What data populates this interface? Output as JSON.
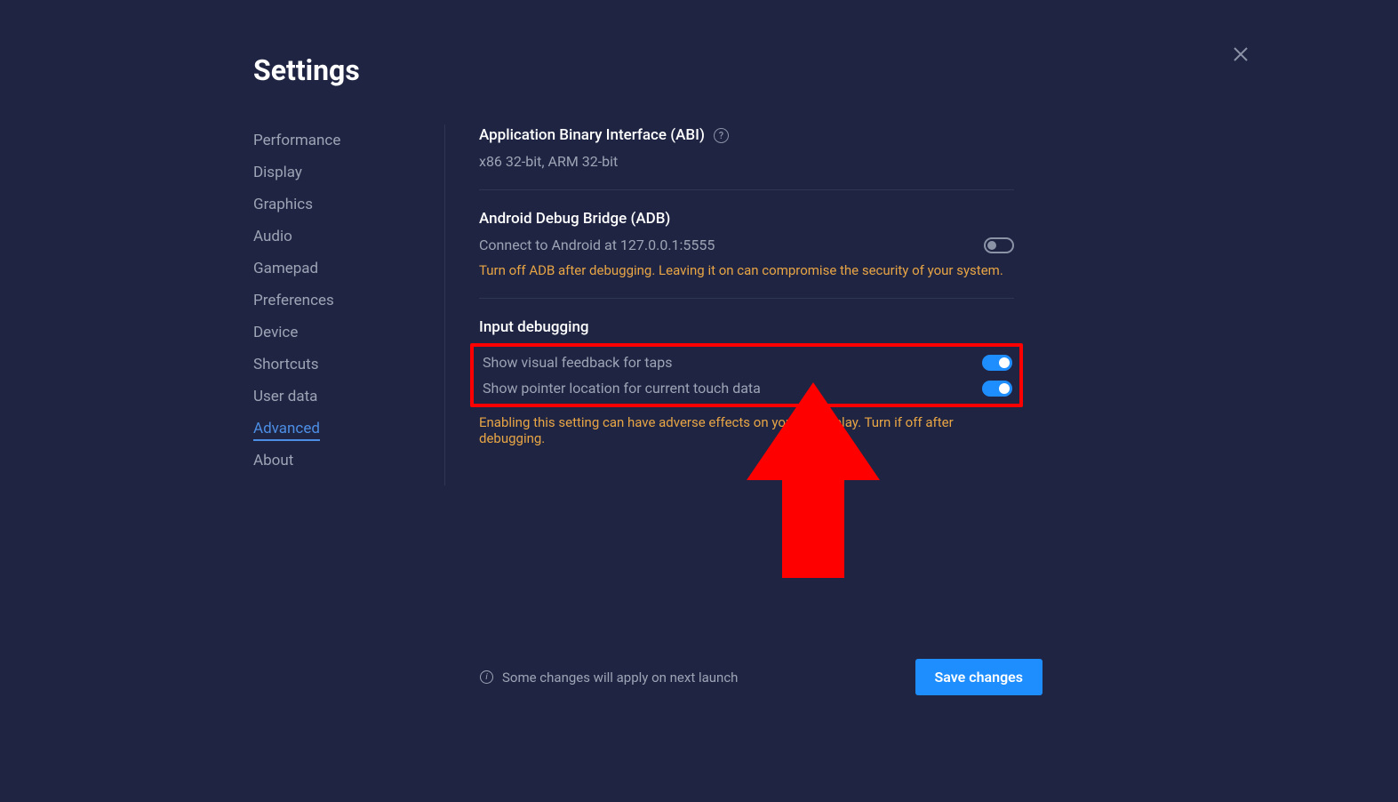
{
  "title": "Settings",
  "sidebar": {
    "items": [
      {
        "label": "Performance"
      },
      {
        "label": "Display"
      },
      {
        "label": "Graphics"
      },
      {
        "label": "Audio"
      },
      {
        "label": "Gamepad"
      },
      {
        "label": "Preferences"
      },
      {
        "label": "Device"
      },
      {
        "label": "Shortcuts"
      },
      {
        "label": "User data"
      },
      {
        "label": "Advanced"
      },
      {
        "label": "About"
      }
    ],
    "active_index": 9
  },
  "abi": {
    "title": "Application Binary Interface (ABI)",
    "value": "x86 32-bit, ARM 32-bit"
  },
  "adb": {
    "title": "Android Debug Bridge (ADB)",
    "desc": "Connect to Android at 127.0.0.1:5555",
    "warning": "Turn off ADB after debugging. Leaving it on can compromise the security of your system."
  },
  "input_debug": {
    "title": "Input debugging",
    "row1": "Show visual feedback for taps",
    "row2": "Show pointer location for current touch data",
    "warning": "Enabling this setting can have adverse effects on your gameplay. Turn if off after debugging."
  },
  "footer": {
    "note": "Some changes will apply on next launch",
    "save": "Save changes"
  }
}
